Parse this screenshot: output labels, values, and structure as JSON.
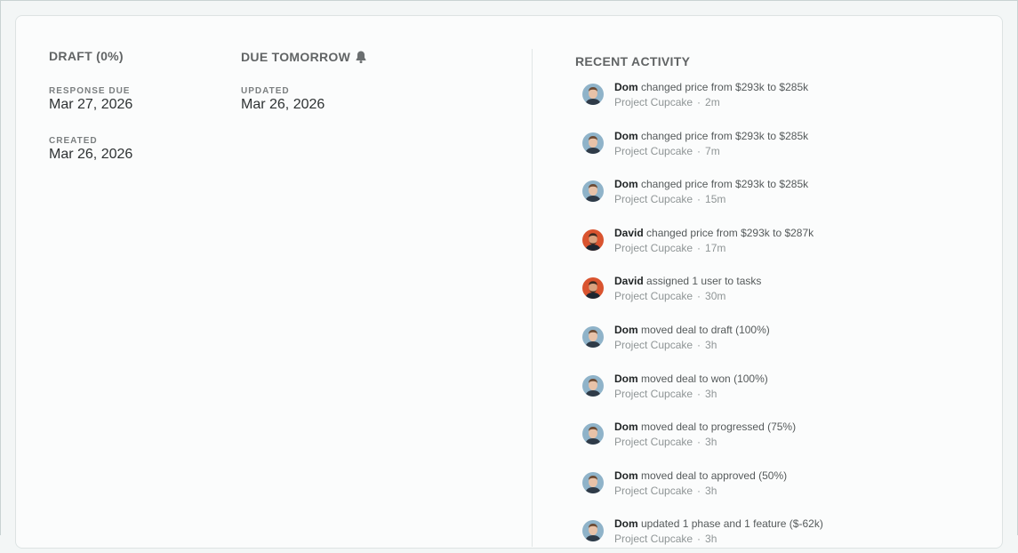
{
  "status": {
    "heading": "DRAFT (0%)",
    "response_due_label": "RESPONSE DUE",
    "response_due_value": "Mar 27, 2026",
    "created_label": "CREATED",
    "created_value": "Mar 26, 2026"
  },
  "due": {
    "heading": "DUE TOMORROW",
    "icon": "bell-icon",
    "updated_label": "UPDATED",
    "updated_value": "Mar 26, 2026"
  },
  "activity": {
    "title": "RECENT ACTIVITY",
    "items": [
      {
        "user": "Dom",
        "action": "changed price from $293k to $285k",
        "project": "Project Cupcake",
        "time": "2m",
        "avatar": "dom"
      },
      {
        "user": "Dom",
        "action": "changed price from $293k to $285k",
        "project": "Project Cupcake",
        "time": "7m",
        "avatar": "dom"
      },
      {
        "user": "Dom",
        "action": "changed price from $293k to $285k",
        "project": "Project Cupcake",
        "time": "15m",
        "avatar": "dom"
      },
      {
        "user": "David",
        "action": "changed price from $293k to $287k",
        "project": "Project Cupcake",
        "time": "17m",
        "avatar": "david"
      },
      {
        "user": "David",
        "action": "assigned 1 user to tasks",
        "project": "Project Cupcake",
        "time": "30m",
        "avatar": "david"
      },
      {
        "user": "Dom",
        "action": "moved deal to draft (100%)",
        "project": "Project Cupcake",
        "time": "3h",
        "avatar": "dom"
      },
      {
        "user": "Dom",
        "action": "moved deal to won (100%)",
        "project": "Project Cupcake",
        "time": "3h",
        "avatar": "dom"
      },
      {
        "user": "Dom",
        "action": "moved deal to progressed (75%)",
        "project": "Project Cupcake",
        "time": "3h",
        "avatar": "dom"
      },
      {
        "user": "Dom",
        "action": "moved deal to approved (50%)",
        "project": "Project Cupcake",
        "time": "3h",
        "avatar": "dom"
      },
      {
        "user": "Dom",
        "action": "updated 1 phase and 1 feature ($-62k)",
        "project": "Project Cupcake",
        "time": "3h",
        "avatar": "dom"
      }
    ]
  },
  "colors": {
    "dom_avatar_bg": "#8fb3c9",
    "david_avatar_bg": "#d9542f"
  }
}
